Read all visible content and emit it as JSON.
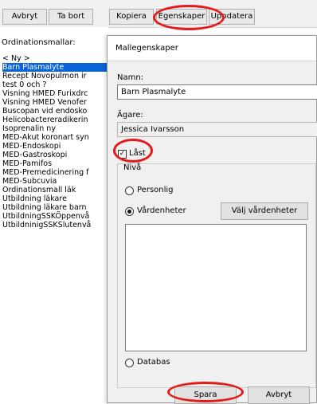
{
  "toolbar": {
    "buttons": [
      {
        "label": "Avbryt"
      },
      {
        "label": "Ta bort"
      },
      {
        "label": "Kopiera"
      },
      {
        "label": "Egenskaper"
      },
      {
        "label": "Uppdatera"
      }
    ]
  },
  "left_panel": {
    "label": "Ordinationsmallar:",
    "items": [
      "< Ny >",
      "Barn Plasmalyte",
      "Recept Novopulmon ir",
      "test 0 och ?",
      "Visning HMED Furixdrc",
      "Visning HMED Venofer",
      "Buscopan vid endosko",
      "Helicobactereradikerin",
      "Isoprenalin ny",
      "MED-Akut koronart syn",
      "MED-Endoskopi",
      "MED-Gastroskopi",
      "MED-Pamifos",
      "MED-Premedicinering f",
      "MED-Subcuvia",
      "Ordinationsmall läk",
      "Utbildning läkare",
      "Utbildning läkare barn",
      "UtbildningSSKÖppenvå",
      "UtbildninigSSKSlutenvå"
    ],
    "selected_index": 1
  },
  "dialog": {
    "title": "Mallegenskaper",
    "name_label": "Namn:",
    "name_value": "Barn Plasmalyte",
    "owner_label": "Ägare:",
    "owner_value": "Jessica Ivarsson",
    "locked_label": "Låst",
    "locked_checked": true,
    "level_label": "Nivå",
    "radio_personal": "Personlig",
    "radio_units": "Vårdenheter",
    "radio_database": "Databas",
    "selected_level": "Vårdenheter",
    "choose_units_button": "Välj vårdenheter",
    "save_button": "Spara",
    "cancel_button": "Avbryt"
  },
  "colors": {
    "highlight": "#e51a1a",
    "selection": "#0a64d6"
  }
}
